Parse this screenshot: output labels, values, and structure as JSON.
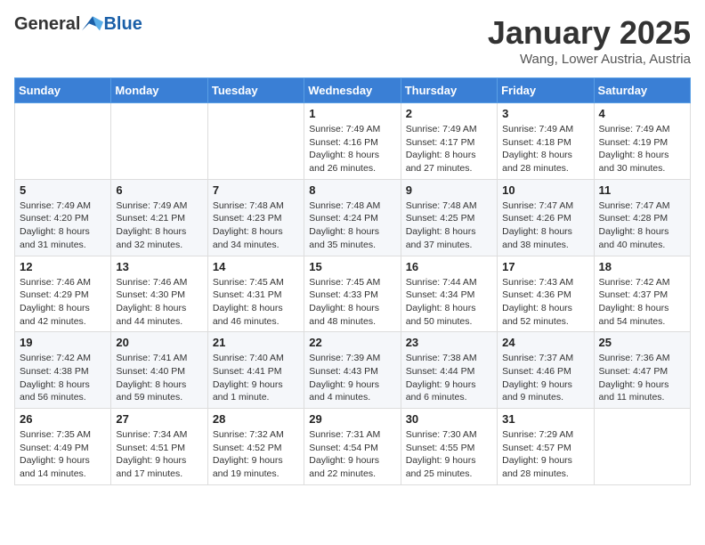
{
  "header": {
    "logo_general": "General",
    "logo_blue": "Blue",
    "month_title": "January 2025",
    "location": "Wang, Lower Austria, Austria"
  },
  "days_of_week": [
    "Sunday",
    "Monday",
    "Tuesday",
    "Wednesday",
    "Thursday",
    "Friday",
    "Saturday"
  ],
  "weeks": [
    [
      {
        "day": "",
        "info": ""
      },
      {
        "day": "",
        "info": ""
      },
      {
        "day": "",
        "info": ""
      },
      {
        "day": "1",
        "info": "Sunrise: 7:49 AM\nSunset: 4:16 PM\nDaylight: 8 hours and 26 minutes."
      },
      {
        "day": "2",
        "info": "Sunrise: 7:49 AM\nSunset: 4:17 PM\nDaylight: 8 hours and 27 minutes."
      },
      {
        "day": "3",
        "info": "Sunrise: 7:49 AM\nSunset: 4:18 PM\nDaylight: 8 hours and 28 minutes."
      },
      {
        "day": "4",
        "info": "Sunrise: 7:49 AM\nSunset: 4:19 PM\nDaylight: 8 hours and 30 minutes."
      }
    ],
    [
      {
        "day": "5",
        "info": "Sunrise: 7:49 AM\nSunset: 4:20 PM\nDaylight: 8 hours and 31 minutes."
      },
      {
        "day": "6",
        "info": "Sunrise: 7:49 AM\nSunset: 4:21 PM\nDaylight: 8 hours and 32 minutes."
      },
      {
        "day": "7",
        "info": "Sunrise: 7:48 AM\nSunset: 4:23 PM\nDaylight: 8 hours and 34 minutes."
      },
      {
        "day": "8",
        "info": "Sunrise: 7:48 AM\nSunset: 4:24 PM\nDaylight: 8 hours and 35 minutes."
      },
      {
        "day": "9",
        "info": "Sunrise: 7:48 AM\nSunset: 4:25 PM\nDaylight: 8 hours and 37 minutes."
      },
      {
        "day": "10",
        "info": "Sunrise: 7:47 AM\nSunset: 4:26 PM\nDaylight: 8 hours and 38 minutes."
      },
      {
        "day": "11",
        "info": "Sunrise: 7:47 AM\nSunset: 4:28 PM\nDaylight: 8 hours and 40 minutes."
      }
    ],
    [
      {
        "day": "12",
        "info": "Sunrise: 7:46 AM\nSunset: 4:29 PM\nDaylight: 8 hours and 42 minutes."
      },
      {
        "day": "13",
        "info": "Sunrise: 7:46 AM\nSunset: 4:30 PM\nDaylight: 8 hours and 44 minutes."
      },
      {
        "day": "14",
        "info": "Sunrise: 7:45 AM\nSunset: 4:31 PM\nDaylight: 8 hours and 46 minutes."
      },
      {
        "day": "15",
        "info": "Sunrise: 7:45 AM\nSunset: 4:33 PM\nDaylight: 8 hours and 48 minutes."
      },
      {
        "day": "16",
        "info": "Sunrise: 7:44 AM\nSunset: 4:34 PM\nDaylight: 8 hours and 50 minutes."
      },
      {
        "day": "17",
        "info": "Sunrise: 7:43 AM\nSunset: 4:36 PM\nDaylight: 8 hours and 52 minutes."
      },
      {
        "day": "18",
        "info": "Sunrise: 7:42 AM\nSunset: 4:37 PM\nDaylight: 8 hours and 54 minutes."
      }
    ],
    [
      {
        "day": "19",
        "info": "Sunrise: 7:42 AM\nSunset: 4:38 PM\nDaylight: 8 hours and 56 minutes."
      },
      {
        "day": "20",
        "info": "Sunrise: 7:41 AM\nSunset: 4:40 PM\nDaylight: 8 hours and 59 minutes."
      },
      {
        "day": "21",
        "info": "Sunrise: 7:40 AM\nSunset: 4:41 PM\nDaylight: 9 hours and 1 minute."
      },
      {
        "day": "22",
        "info": "Sunrise: 7:39 AM\nSunset: 4:43 PM\nDaylight: 9 hours and 4 minutes."
      },
      {
        "day": "23",
        "info": "Sunrise: 7:38 AM\nSunset: 4:44 PM\nDaylight: 9 hours and 6 minutes."
      },
      {
        "day": "24",
        "info": "Sunrise: 7:37 AM\nSunset: 4:46 PM\nDaylight: 9 hours and 9 minutes."
      },
      {
        "day": "25",
        "info": "Sunrise: 7:36 AM\nSunset: 4:47 PM\nDaylight: 9 hours and 11 minutes."
      }
    ],
    [
      {
        "day": "26",
        "info": "Sunrise: 7:35 AM\nSunset: 4:49 PM\nDaylight: 9 hours and 14 minutes."
      },
      {
        "day": "27",
        "info": "Sunrise: 7:34 AM\nSunset: 4:51 PM\nDaylight: 9 hours and 17 minutes."
      },
      {
        "day": "28",
        "info": "Sunrise: 7:32 AM\nSunset: 4:52 PM\nDaylight: 9 hours and 19 minutes."
      },
      {
        "day": "29",
        "info": "Sunrise: 7:31 AM\nSunset: 4:54 PM\nDaylight: 9 hours and 22 minutes."
      },
      {
        "day": "30",
        "info": "Sunrise: 7:30 AM\nSunset: 4:55 PM\nDaylight: 9 hours and 25 minutes."
      },
      {
        "day": "31",
        "info": "Sunrise: 7:29 AM\nSunset: 4:57 PM\nDaylight: 9 hours and 28 minutes."
      },
      {
        "day": "",
        "info": ""
      }
    ]
  ]
}
